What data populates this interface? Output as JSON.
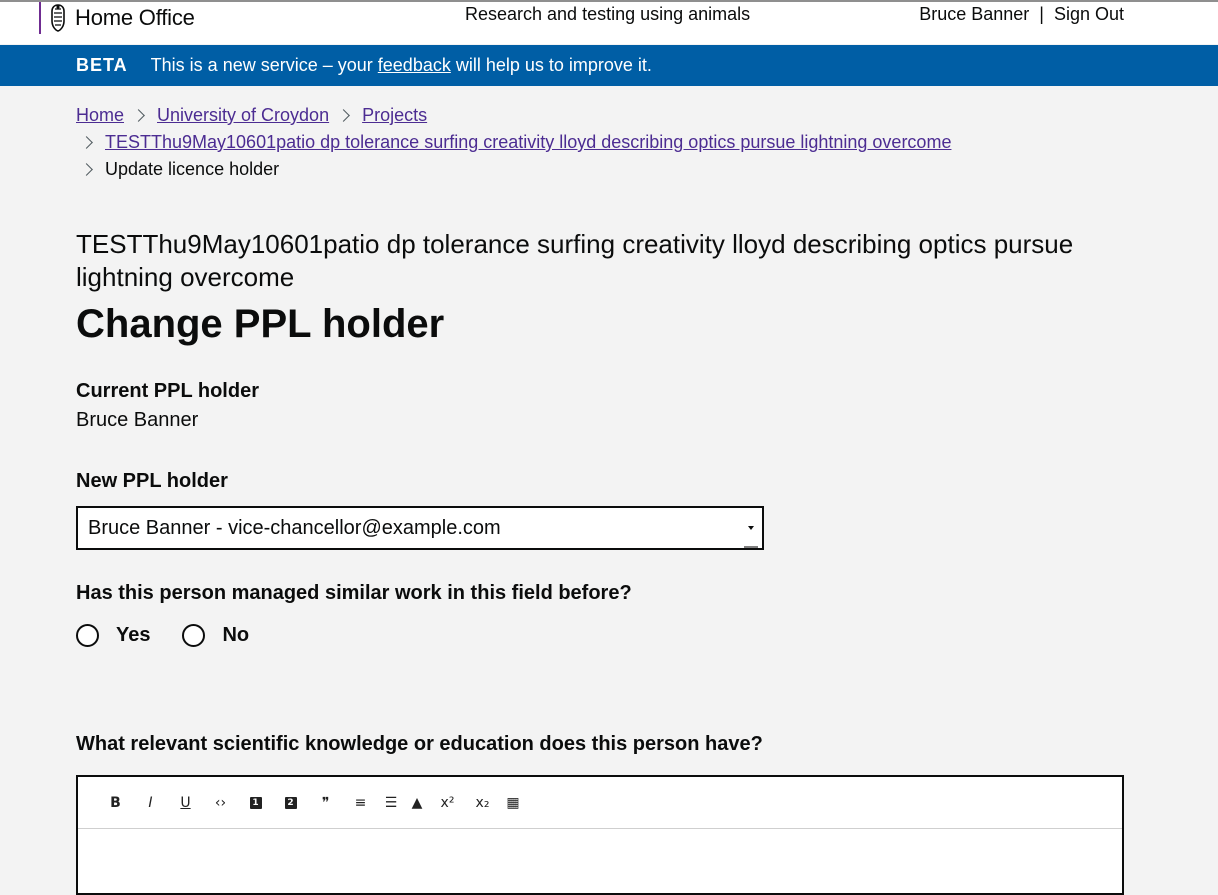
{
  "header": {
    "brand": "Home Office",
    "service_name": "Research and testing using animals",
    "user_name": "Bruce Banner",
    "separator": "|",
    "sign_out": "Sign Out"
  },
  "beta": {
    "tag": "BETA",
    "text_before": "This is a new service – your",
    "link": "feedback",
    "text_after": "will help us to improve it."
  },
  "breadcrumbs": [
    {
      "label": "Home"
    },
    {
      "label": "University of Croydon"
    },
    {
      "label": "Projects"
    },
    {
      "label": "TESTThu9May10601patio dp tolerance surfing creativity lloyd describing optics pursue lightning overcome"
    },
    {
      "label": "Update licence holder"
    }
  ],
  "page": {
    "caption": "TESTThu9May10601patio dp tolerance surfing creativity lloyd describing optics pursue lightning overcome",
    "title": "Change PPL holder"
  },
  "form": {
    "current_label": "Current PPL holder",
    "current_value": "Bruce Banner",
    "new_label": "New PPL holder",
    "new_value": "Bruce Banner - vice-chancellor@example.com",
    "q_experience": "Has this person managed similar work in this field before?",
    "options": [
      "Yes",
      "No"
    ],
    "q_knowledge": "What relevant scientific knowledge or education does this person have?"
  },
  "toolbar": {
    "bold": "B",
    "italic": "I",
    "underline": "U",
    "code": "‹›",
    "h1": "1",
    "h2": "2",
    "quote": "❞",
    "ordered": "≡",
    "bulleted": "☰",
    "image": "▲",
    "sup": "x²",
    "sub": "x₂",
    "table": "▦"
  },
  "colors": {
    "beta_bg": "#005ea5",
    "link": "#4c2c92",
    "brand_rule": "#6f2c91"
  }
}
